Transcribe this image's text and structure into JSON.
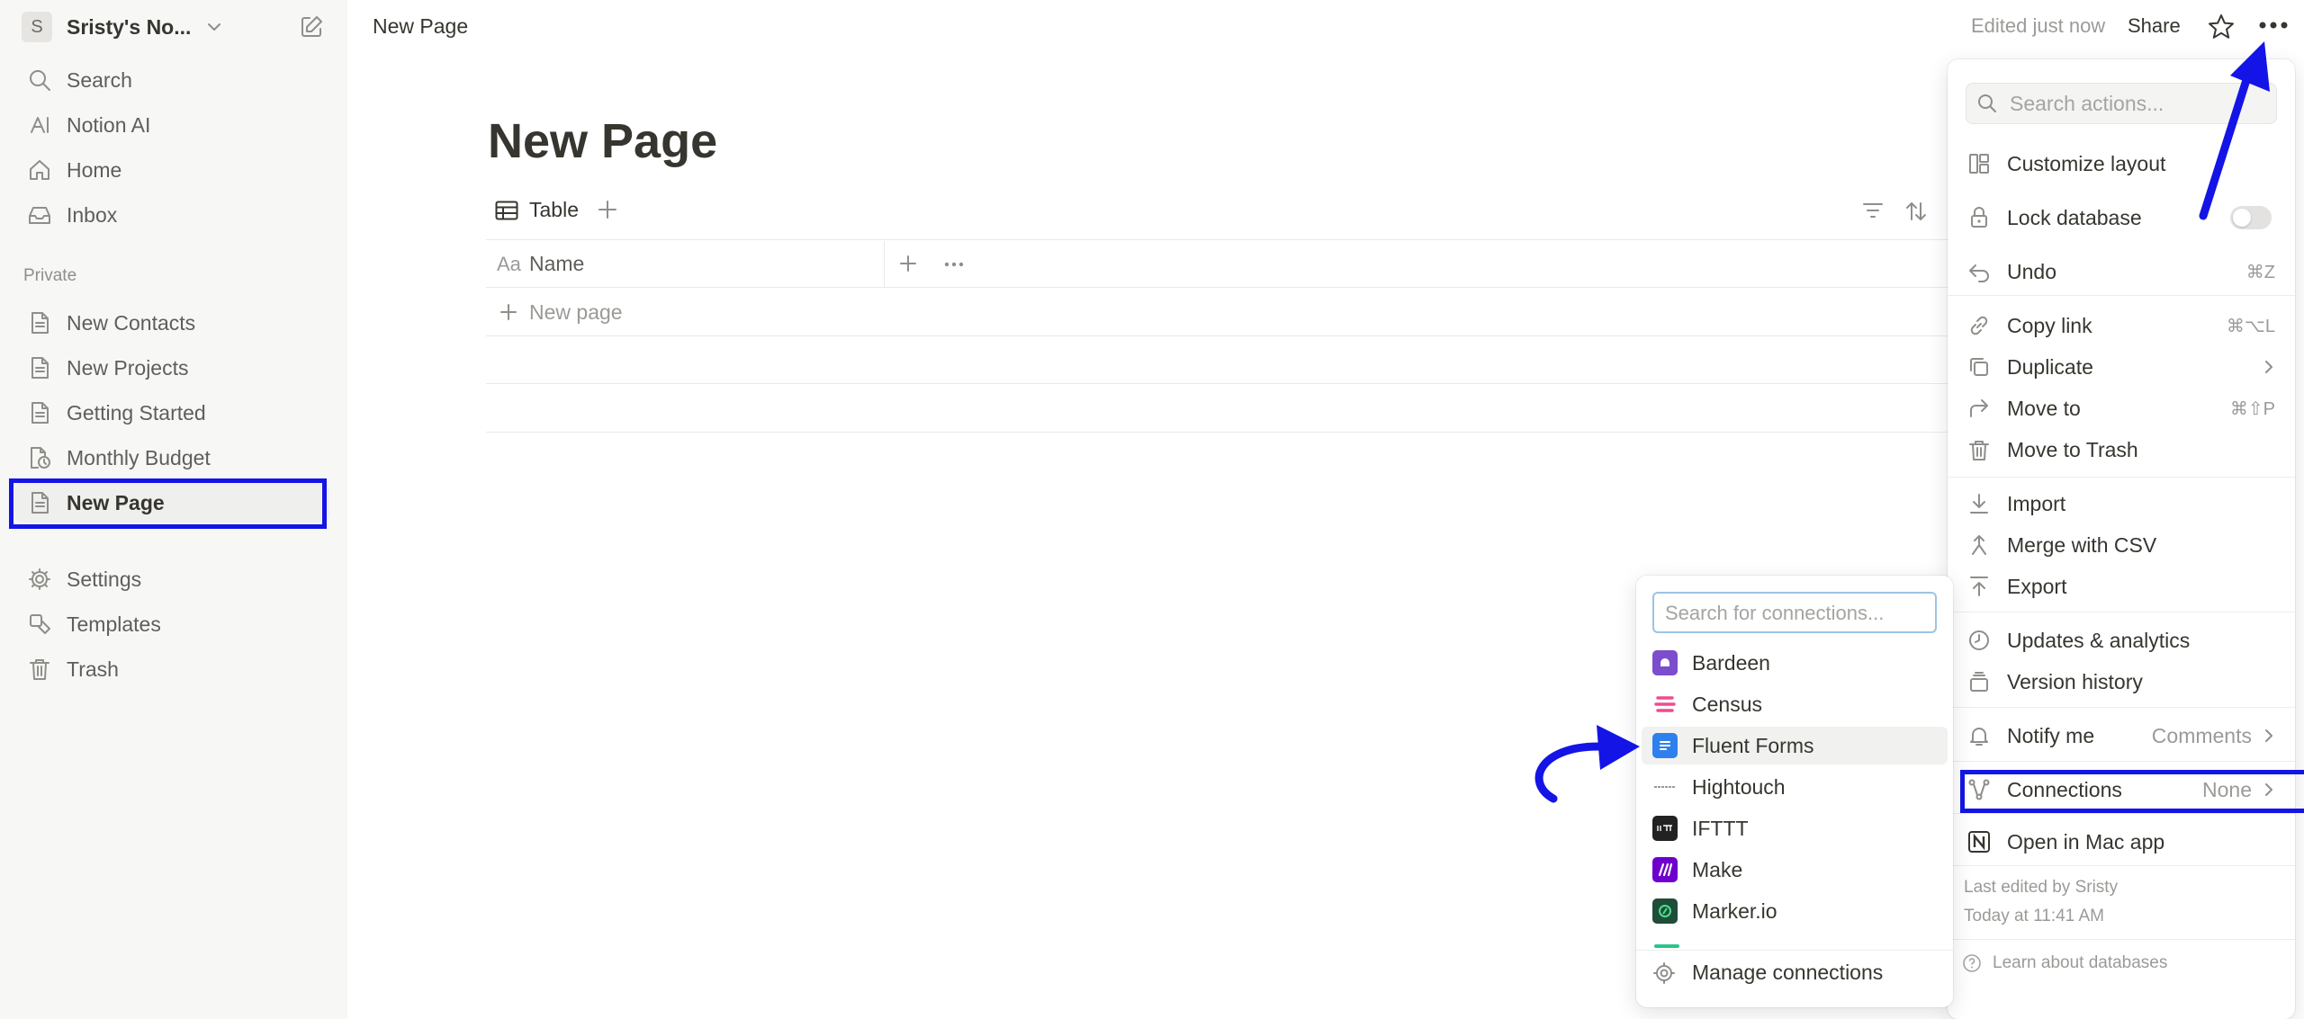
{
  "workspace": {
    "initial": "S",
    "name": "Sristy's No..."
  },
  "sidebar": {
    "top_items": [
      {
        "label": "Search",
        "icon": "search-icon"
      },
      {
        "label": "Notion AI",
        "icon": "notion-ai-icon"
      },
      {
        "label": "Home",
        "icon": "home-icon"
      },
      {
        "label": "Inbox",
        "icon": "inbox-icon"
      }
    ],
    "section_label": "Private",
    "private_items": [
      {
        "label": "New Contacts",
        "icon": "page-icon"
      },
      {
        "label": "New Projects",
        "icon": "page-icon"
      },
      {
        "label": "Getting Started",
        "icon": "page-icon"
      },
      {
        "label": "Monthly Budget",
        "icon": "database-icon"
      },
      {
        "label": "New Page",
        "icon": "page-icon",
        "active": true
      }
    ],
    "bottom_items": [
      {
        "label": "Settings",
        "icon": "settings-icon"
      },
      {
        "label": "Templates",
        "icon": "templates-icon"
      },
      {
        "label": "Trash",
        "icon": "trash-icon"
      }
    ]
  },
  "topbar": {
    "breadcrumb": "New Page",
    "edited": "Edited just now",
    "share": "Share"
  },
  "page": {
    "title": "New Page",
    "view_tab": "Table",
    "column_type": "Aa",
    "column_name": "Name",
    "new_row": "New page"
  },
  "actions_menu": {
    "search_placeholder": "Search actions...",
    "items": {
      "customize_layout": "Customize layout",
      "lock_database": "Lock database",
      "undo": "Undo",
      "undo_shortcut": "⌘Z",
      "copy_link": "Copy link",
      "copy_link_shortcut": "⌘⌥L",
      "duplicate": "Duplicate",
      "move_to": "Move to",
      "move_to_shortcut": "⌘⇧P",
      "move_to_trash": "Move to Trash",
      "import": "Import",
      "merge_csv": "Merge with CSV",
      "export": "Export",
      "updates": "Updates & analytics",
      "version_history": "Version history",
      "notify_me": "Notify me",
      "notify_value": "Comments",
      "connections": "Connections",
      "connections_value": "None",
      "open_mac": "Open in Mac app"
    },
    "lock_enabled": false,
    "last_edited_by": "Last edited by Sristy",
    "last_edited_time": "Today at 11:41 AM",
    "learn": "Learn about databases"
  },
  "connections_menu": {
    "search_placeholder": "Search for connections...",
    "items": [
      {
        "label": "Bardeen",
        "color": "#7c4dcc"
      },
      {
        "label": "Census",
        "color": "#f04a8f"
      },
      {
        "label": "Fluent Forms",
        "color": "#2f80ed",
        "hover": true
      },
      {
        "label": "Hightouch",
        "color": "#b0b0b0"
      },
      {
        "label": "IFTTT",
        "color": "#222222"
      },
      {
        "label": "Make",
        "color": "#6d00cc"
      },
      {
        "label": "Marker.io",
        "color": "#1f4d3a"
      }
    ],
    "manage": "Manage connections"
  },
  "colors": {
    "annotation": "#1414e6",
    "accent_focus": "#9cc3e5"
  }
}
